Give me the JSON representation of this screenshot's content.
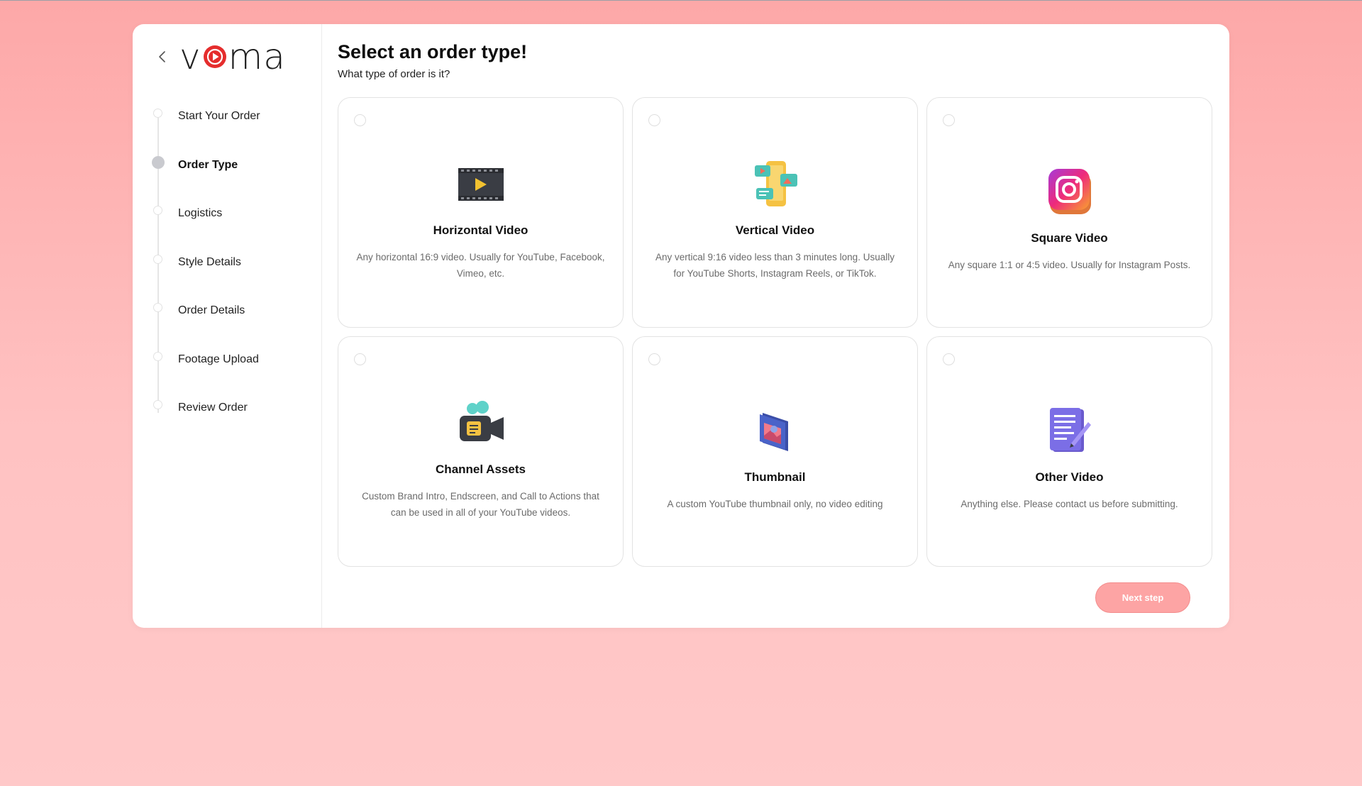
{
  "app": {
    "logo_text_left": "v",
    "logo_text_right": "ma"
  },
  "sidebar": {
    "steps": [
      {
        "label": "Start Your Order",
        "active": false
      },
      {
        "label": "Order Type",
        "active": true
      },
      {
        "label": "Logistics",
        "active": false
      },
      {
        "label": "Style Details",
        "active": false
      },
      {
        "label": "Order Details",
        "active": false
      },
      {
        "label": "Footage Upload",
        "active": false
      },
      {
        "label": "Review Order",
        "active": false
      }
    ]
  },
  "main": {
    "title": "Select an order type!",
    "subtitle": "What type of order is it?",
    "options": [
      {
        "title": "Horizontal Video",
        "desc": "Any horizontal 16:9 video. Usually for YouTube, Facebook, Vimeo, etc.",
        "icon": "film-strip-icon"
      },
      {
        "title": "Vertical Video",
        "desc": "Any vertical 9:16 video less than 3 minutes long. Usually for YouTube Shorts, Instagram Reels, or TikTok.",
        "icon": "phone-icon"
      },
      {
        "title": "Square Video",
        "desc": "Any square 1:1 or 4:5 video. Usually for Instagram Posts.",
        "icon": "instagram-icon"
      },
      {
        "title": "Channel Assets",
        "desc": "Custom Brand Intro, Endscreen, and Call to Actions that can be used in all of your YouTube videos.",
        "icon": "video-camera-icon"
      },
      {
        "title": "Thumbnail",
        "desc": "A custom YouTube thumbnail only, no video editing",
        "icon": "image-icon"
      },
      {
        "title": "Other Video",
        "desc": "Anything else. Please contact us before submitting.",
        "icon": "document-pen-icon"
      }
    ],
    "next_label": "Next step"
  },
  "colors": {
    "accent": "#fda4a4",
    "brand_red": "#e52d2d",
    "background": "#ffbcbc"
  }
}
